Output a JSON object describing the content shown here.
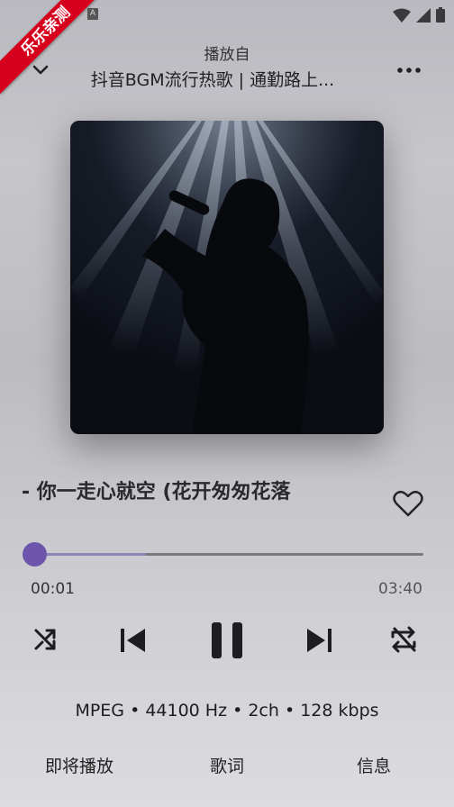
{
  "status_bar": {
    "notification_badge": "A",
    "icons": [
      "wifi-icon",
      "signal-icon",
      "battery-icon"
    ]
  },
  "ribbon": {
    "text": "乐乐亲测"
  },
  "header": {
    "subtitle": "播放自",
    "title": "抖音BGM流行热歌 | 通勤路上..."
  },
  "song": {
    "title": "- 你一走心就空 (花开匆匆花落"
  },
  "progress": {
    "current_time": "00:01",
    "total_time": "03:40",
    "played_fraction": 0.005,
    "buffered_fraction": 0.29
  },
  "controls": {
    "icons": [
      "shuffle-icon",
      "skip-previous-icon",
      "pause-icon",
      "skip-next-icon",
      "repeat-off-icon"
    ]
  },
  "audio_info": "MPEG • 44100 Hz • 2ch • 128 kbps",
  "tabs": [
    {
      "label": "即将播放"
    },
    {
      "label": "歌词"
    },
    {
      "label": "信息"
    }
  ],
  "colors": {
    "accent": "#6d55ab",
    "ribbon": "#d6001c"
  }
}
